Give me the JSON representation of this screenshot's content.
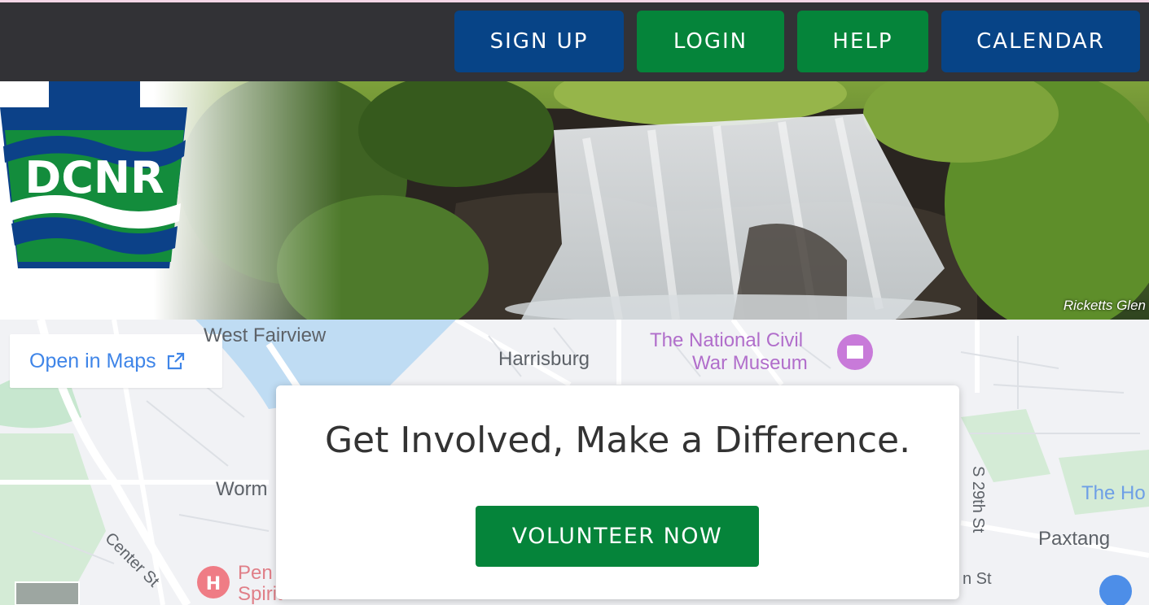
{
  "nav": {
    "signup": "SIGN UP",
    "login": "LOGIN",
    "help": "HELP",
    "calendar": "CALENDAR"
  },
  "banner": {
    "logo_text": "DCNR",
    "caption": "Ricketts Glen"
  },
  "map": {
    "open_in_maps": "Open in Maps",
    "labels": {
      "west_fairview": "West Fairview",
      "harrisburg": "Harrisburg",
      "museum": "The National Civil War Museum",
      "museum_line1": "The National Civil",
      "museum_line2": "War Museum",
      "worm": "Worm",
      "center_st": "Center St",
      "s29th": "S 29th St",
      "paxtang": "Paxtang",
      "the_ho": "The Ho",
      "pen": "Pen",
      "spirit": "Spirit",
      "n_st": "n St"
    }
  },
  "hero": {
    "title": "Get Involved, Make a Difference.",
    "cta": "VOLUNTEER NOW"
  },
  "colors": {
    "nav_bg": "#323236",
    "blue": "#074487",
    "green": "#05843a",
    "link_blue": "#3f85e8"
  }
}
